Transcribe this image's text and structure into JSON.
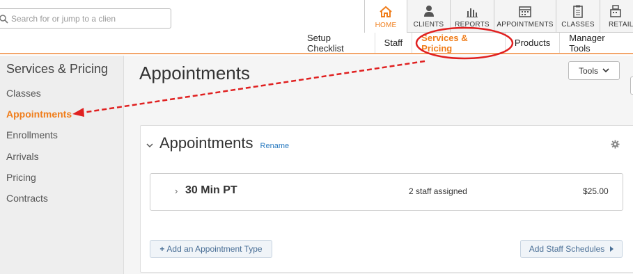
{
  "search": {
    "placeholder": "Search for or jump to a clien"
  },
  "nav_tabs": [
    {
      "label": "HOME",
      "icon": "home-icon",
      "active": true
    },
    {
      "label": "CLIENTS",
      "icon": "person-icon"
    },
    {
      "label": "REPORTS",
      "icon": "bar-chart-icon"
    },
    {
      "label": "APPOINTMENTS",
      "icon": "calendar-icon"
    },
    {
      "label": "CLASSES",
      "icon": "clipboard-icon"
    },
    {
      "label": "RETAIL",
      "icon": "register-icon"
    }
  ],
  "sub_nav": [
    {
      "label": "Setup Checklist"
    },
    {
      "label": "Staff"
    },
    {
      "label": "Services & Pricing",
      "active": true
    },
    {
      "label": "Products"
    },
    {
      "label": "Manager Tools"
    }
  ],
  "sidebar": {
    "title": "Services & Pricing",
    "items": [
      {
        "label": "Classes"
      },
      {
        "label": "Appointments",
        "active": true
      },
      {
        "label": "Enrollments"
      },
      {
        "label": "Arrivals"
      },
      {
        "label": "Pricing"
      },
      {
        "label": "Contracts"
      }
    ]
  },
  "main": {
    "title": "Appointments",
    "tools_label": "Tools",
    "panel": {
      "title": "Appointments",
      "rename_label": "Rename",
      "rows": [
        {
          "name": "30 Min PT",
          "staff": "2 staff assigned",
          "price": "$25.00"
        }
      ],
      "add_type_label": "Add an Appointment Type",
      "add_schedules_label": "Add Staff Schedules"
    }
  },
  "colors": {
    "accent": "#f07d1a",
    "annotation": "#e02020",
    "link": "#2a7bc0"
  }
}
